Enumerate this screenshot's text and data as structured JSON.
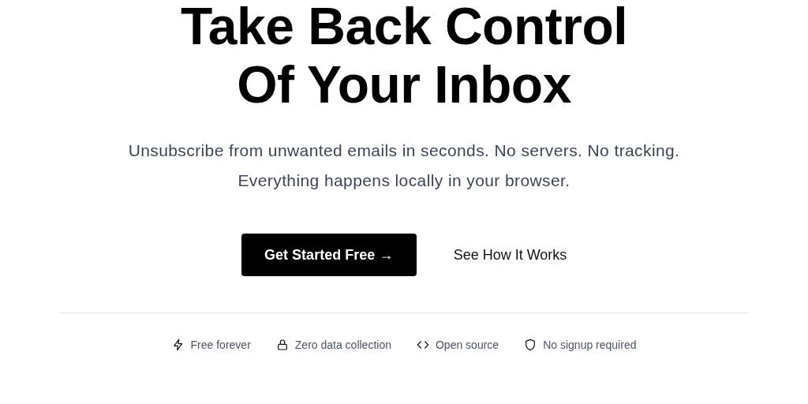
{
  "hero": {
    "heading_lines": [
      "Take Back Control",
      "Of Your Inbox"
    ],
    "subtitle": [
      "Unsubscribe from unwanted emails in seconds. No servers. No tracking.",
      "Everything happens locally in your browser."
    ],
    "primary_button": "Get Started Free →",
    "secondary_link": "See How It Works"
  },
  "features": [
    {
      "kind": "bolt",
      "label": "Free forever"
    },
    {
      "kind": "lock",
      "label": "Zero data collection"
    },
    {
      "kind": "code",
      "label": "Open source"
    },
    {
      "kind": "shield",
      "label": "No signup required"
    }
  ]
}
